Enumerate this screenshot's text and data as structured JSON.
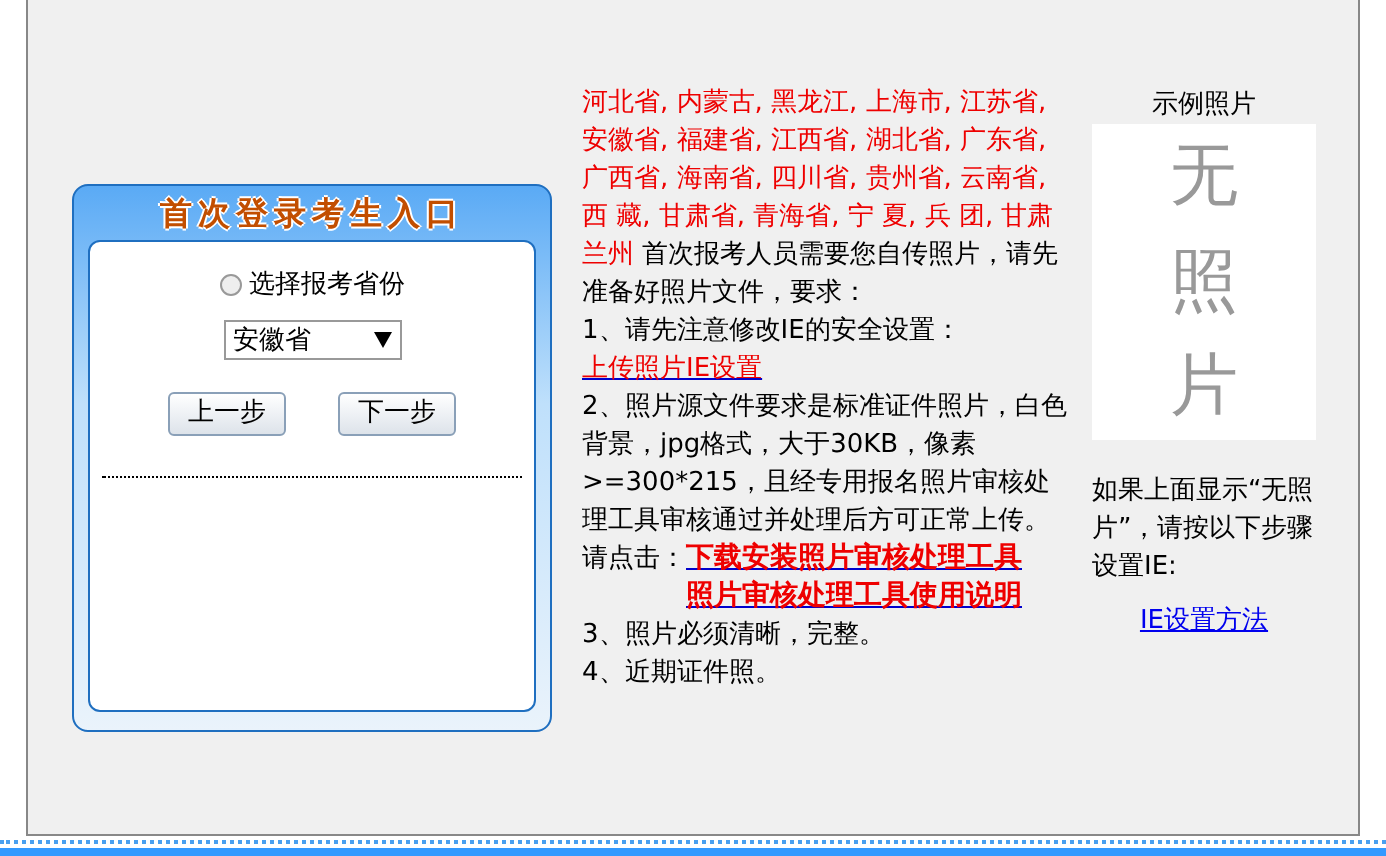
{
  "login_box": {
    "title": "首次登录考生入口",
    "radio": {
      "label": "选择报考省份",
      "checked": false
    },
    "province_select": {
      "value": "安徽省"
    },
    "buttons": [
      "上一步",
      "下一步"
    ]
  },
  "notice": {
    "regions": "河北省, 内蒙古, 黑龙江, 上海市, 江苏省, 安徽省, 福建省, 江西省, 湖北省, 广东省, 广西省, 海南省, 四川省, 贵州省, 云南省, 西 藏, 甘肃省, 青海省, 宁 夏, 兵 团, 甘肃兰州",
    "intro": "首次报考人员需要您自传照片，请先准备好照片文件，要求：",
    "items": [
      {
        "kind": "text_link",
        "text": "1、请先注意修改IE的安全设置：",
        "link": "上传照片IE设置"
      },
      {
        "kind": "text",
        "text": "2、照片源文件要求是标准证件照片，白色背景，jpg格式，大于30KB，像素>=300*215，且经专用报名照片审核处理工具审核通过并处理后方可正常上传。"
      },
      {
        "kind": "downloads",
        "text": "请点击：",
        "links": [
          "下载安装照片审核处理工具",
          "照片审核处理工具使用说明"
        ]
      },
      {
        "kind": "text",
        "text": "3、照片必须清晰，完整。"
      },
      {
        "kind": "text",
        "text": "4、近期证件照。"
      }
    ]
  },
  "sample": {
    "caption": "示例照片",
    "placeholder": "无照片",
    "hint": "如果上面显示“无照片”，请按以下步骤设置IE:",
    "link": "IE设置方法"
  }
}
